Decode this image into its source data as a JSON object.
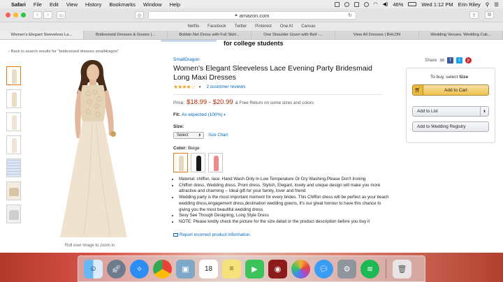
{
  "menubar": {
    "app": "Safari",
    "menus": [
      "File",
      "Edit",
      "View",
      "History",
      "Bookmarks",
      "Window",
      "Help"
    ],
    "battery": "46%",
    "clock": "Wed 1:12 PM",
    "user": "Erin Riley"
  },
  "browser": {
    "url": "amazon.com",
    "favorites": [
      "Netflix",
      "Facebook",
      "Twitter",
      "Pinterest",
      "One.Kl",
      "Canvas"
    ],
    "tabs": [
      "Women's Elegant Sleeveless La...",
      "Bridesmaid Dresses & Gowns |...",
      "Bobbin Net Dress with Full Skirt...",
      "One Shoulder Gown with Belt -...",
      "View All Dresses | BHLDN",
      "Wedding Venues, Wedding Cak..."
    ]
  },
  "page": {
    "header_fragment": "for college students",
    "back_link": "‹ Back to search results for \"bridesmaid dresses smalldragon\"",
    "zoom_hint": "Roll over image to zoom in",
    "brand": "SmallDragon",
    "title": "Women's Elegant Sleeveless Lace Evening Party Bridesmaid Long Maxi Dresses",
    "stars": "★★★★☆",
    "reviews": "2 customer reviews",
    "price_label": "Price:",
    "price": "$18.99 - $20.99",
    "price_note": "& Free Return on some sizes and colors",
    "fit_label": "Fit:",
    "fit_value": "As expected (100%)",
    "size_label": "Size:",
    "size_select": "Select",
    "size_chart": "Size Chart",
    "color_label": "Color:",
    "color_value": "Beige",
    "colors": {
      "beige": "#e8d6b8",
      "black": "#1a1a1a",
      "coral": "#f08a8a",
      "dress": "#efe3cf",
      "lace": "#e4d3b4"
    },
    "bullets": [
      "Material: chiffon, lace. Hand Wash Only In Low Temperature Or Dry Washing,Please Don't Ironing",
      "Chiffon dress, Wedding dress, Prom dress, Stylish, Elegant, lovely and unique design will make you more attractive and charming -- Ideal gift for your family, lover and friend",
      "Wedding party is the most important moment for every brides. This Chiffon dress will be perfect as your beach wedding dress,engagement dress,destination wedding gowns, It's our great honour to have this chance to giving you the most beautiful wedding dress.",
      "Sexy See Though Designing, Long Style Dress",
      "NOTE: Please kindly check the picture for the size detail or the product description before you buy it"
    ],
    "report": "Report incorrect product information."
  },
  "share": {
    "label": "Share"
  },
  "buybox": {
    "select_prefix": "To buy, select",
    "select_bold": "Size",
    "add_to_cart": "Add to Cart",
    "add_to_list": "Add to List",
    "add_to_registry": "Add to Wedding Registry"
  }
}
